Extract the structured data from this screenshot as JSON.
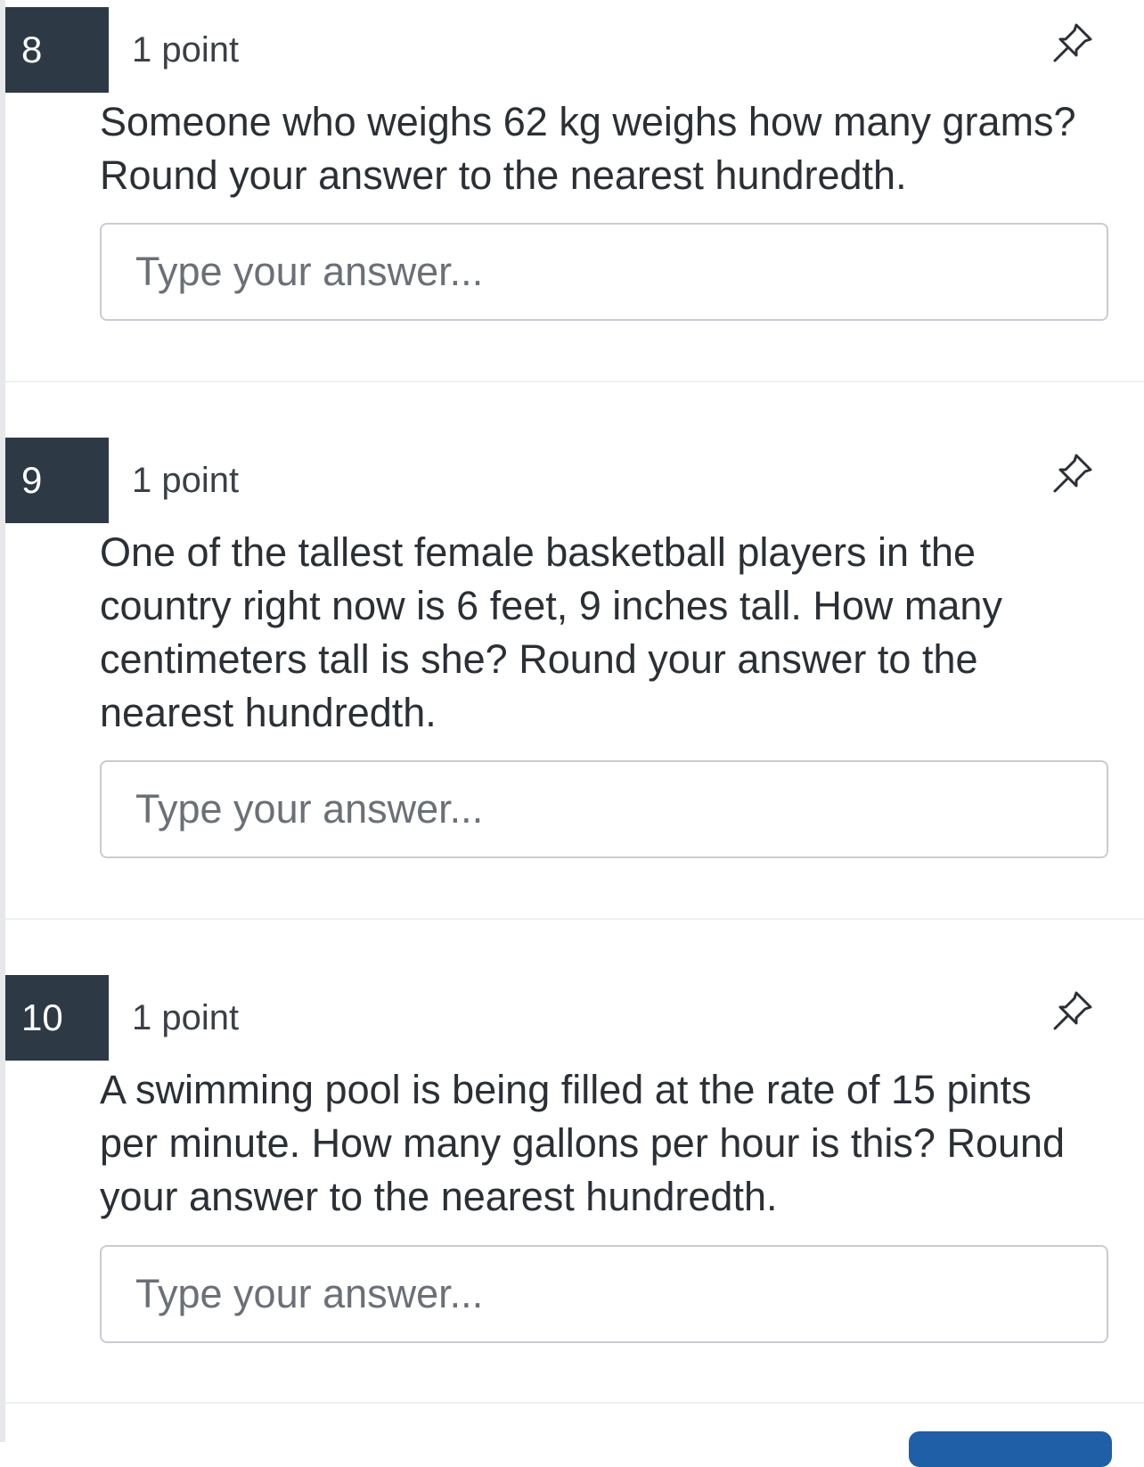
{
  "questions": [
    {
      "number": "8",
      "points": "1 point",
      "text": "Someone who weighs 62 kg weighs how many grams?\n Round your answer to the nearest hundredth.",
      "placeholder": "Type your answer..."
    },
    {
      "number": "9",
      "points": "1 point",
      "text": "One of the tallest female basketball players in the\ncountry right now is 6 feet, 9 inches tall.  How many\ncentimeters tall is she?  Round your answer to the\nnearest hundredth.",
      "placeholder": "Type your answer..."
    },
    {
      "number": "10",
      "points": "1 point",
      "text": "A swimming pool is being filled at the rate of 15 pints\nper minute.  How many gallons per hour is this?  Round\nyour answer to the nearest hundredth.",
      "placeholder": "Type your answer..."
    }
  ],
  "icons": {
    "pin": "pushpin-icon"
  },
  "colors": {
    "number_badge_bg": "#2d3a46",
    "number_badge_text": "#ffffff",
    "text": "#2b2f36",
    "input_border": "#c9ccd0",
    "placeholder": "#6b7078",
    "button": "#1e5fa8"
  }
}
